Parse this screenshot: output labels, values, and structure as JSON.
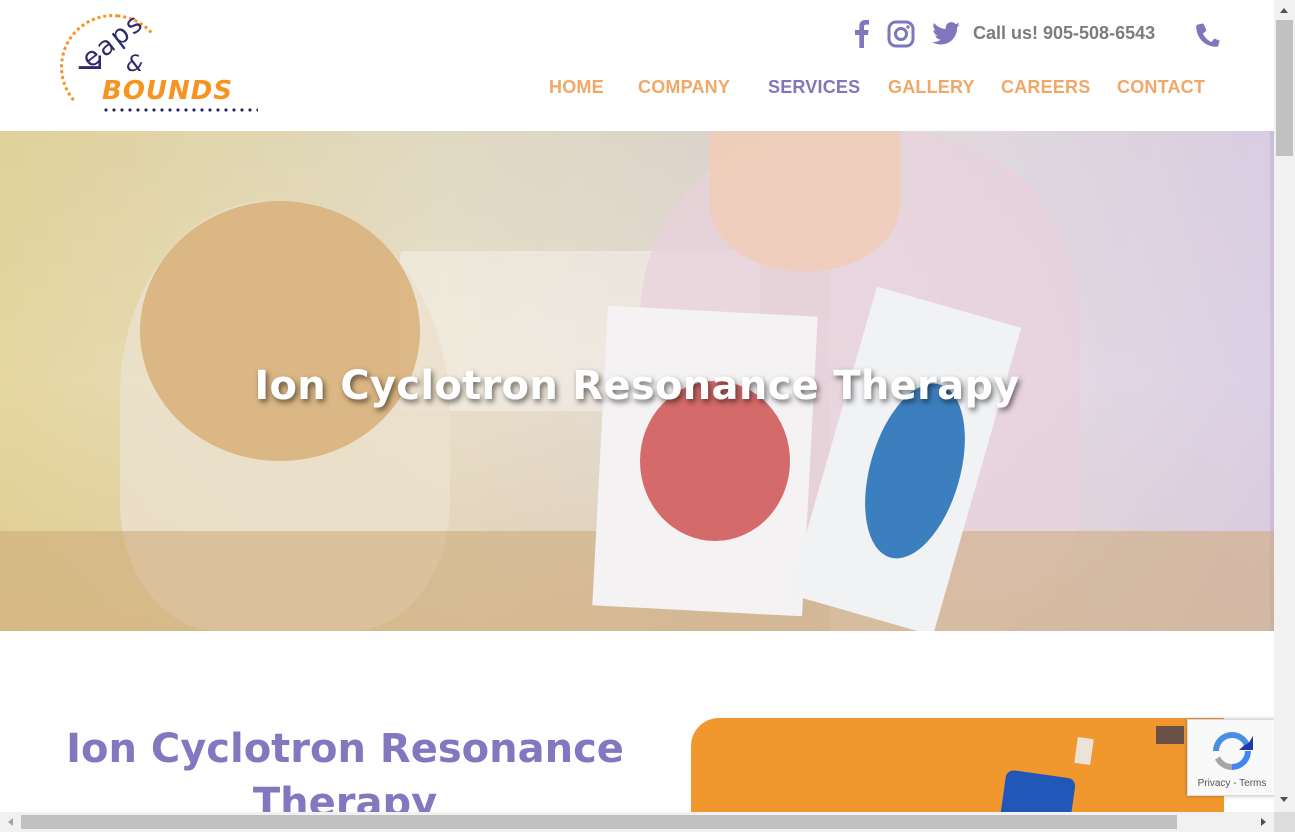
{
  "brand": {
    "logo_top": "Leaps",
    "logo_top_L": "L",
    "logo_top_rest": "eaps",
    "logo_amp": "&",
    "logo_bottom": "BOUNDS",
    "orange": "#f7931e",
    "navy": "#2e2a6b"
  },
  "header": {
    "social_icons": [
      "facebook-icon",
      "instagram-icon",
      "twitter-icon"
    ],
    "call_text": "Call us! 905-508-6543",
    "phone_icon": "phone-icon",
    "accent_purple": "#7e77bb",
    "accent_orange": "#f0a868"
  },
  "nav": {
    "items": [
      {
        "label": "HOME",
        "active": false
      },
      {
        "label": "COMPANY",
        "active": false
      },
      {
        "label": "SERVICES",
        "active": true
      },
      {
        "label": "GALLERY",
        "active": false
      },
      {
        "label": "CAREERS",
        "active": false
      },
      {
        "label": "CONTACT",
        "active": false
      }
    ]
  },
  "hero": {
    "title": "Ion Cyclotron Resonance Therapy"
  },
  "main": {
    "heading": "Ion Cyclotron Resonance Therapy"
  },
  "recaptcha": {
    "links": "Privacy - Terms"
  }
}
